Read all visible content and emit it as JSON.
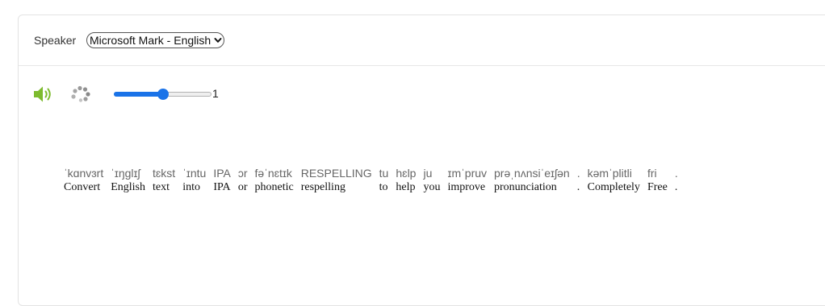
{
  "speaker": {
    "label": "Speaker",
    "selected_voice": "Microsoft Mark - English"
  },
  "controls": {
    "speed_value": "1",
    "speed_fraction": 0.5
  },
  "transcription": [
    {
      "ipa": "ˈkɑnvɜrt",
      "en": "Convert"
    },
    {
      "ipa": "ˈɪŋglɪʃ",
      "en": "English"
    },
    {
      "ipa": "tɛkst",
      "en": "text"
    },
    {
      "ipa": "ˈɪntu",
      "en": "into"
    },
    {
      "ipa": "IPA",
      "en": "IPA"
    },
    {
      "ipa": "ɔr",
      "en": "or"
    },
    {
      "ipa": "fəˈnɛtɪk",
      "en": "phonetic"
    },
    {
      "ipa": "RESPELLING",
      "en": "respelling"
    },
    {
      "ipa": "tu",
      "en": "to"
    },
    {
      "ipa": "hɛlp",
      "en": "help"
    },
    {
      "ipa": "ju",
      "en": "you"
    },
    {
      "ipa": "ɪmˈpruv",
      "en": "improve"
    },
    {
      "ipa": "prəˌnʌnsiˈeɪʃən",
      "en": "pronunciation"
    },
    {
      "ipa": ".",
      "en": "."
    },
    {
      "ipa": "kəmˈplitli",
      "en": "Completely"
    },
    {
      "ipa": "fri",
      "en": "Free"
    },
    {
      "ipa": ".",
      "en": "."
    }
  ],
  "colors": {
    "volume_icon": "#7dbb2e",
    "slider_accent": "#1a73e8",
    "spinner": "#9a9a9a"
  }
}
